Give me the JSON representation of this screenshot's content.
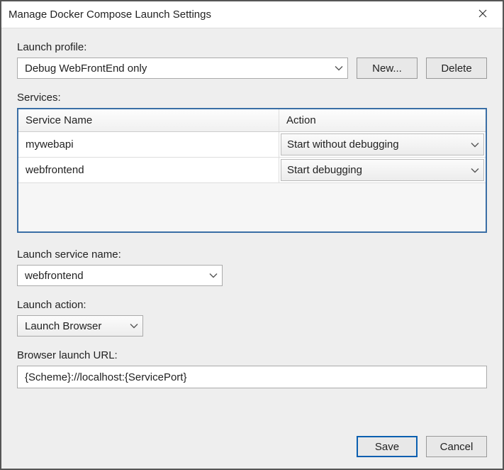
{
  "window": {
    "title": "Manage Docker Compose Launch Settings"
  },
  "labels": {
    "launch_profile": "Launch profile:",
    "services": "Services:",
    "launch_service_name": "Launch service name:",
    "launch_action": "Launch action:",
    "browser_launch_url": "Browser launch URL:"
  },
  "profile": {
    "selected": "Debug WebFrontEnd only"
  },
  "buttons": {
    "new": "New...",
    "delete": "Delete",
    "save": "Save",
    "cancel": "Cancel"
  },
  "services_table": {
    "headers": {
      "name": "Service Name",
      "action": "Action"
    },
    "rows": [
      {
        "name": "mywebapi",
        "action": "Start without debugging"
      },
      {
        "name": "webfrontend",
        "action": "Start debugging"
      }
    ]
  },
  "launch_service_name": {
    "selected": "webfrontend"
  },
  "launch_action": {
    "selected": "Launch Browser"
  },
  "browser_launch_url": {
    "value": "{Scheme}://localhost:{ServicePort}"
  }
}
